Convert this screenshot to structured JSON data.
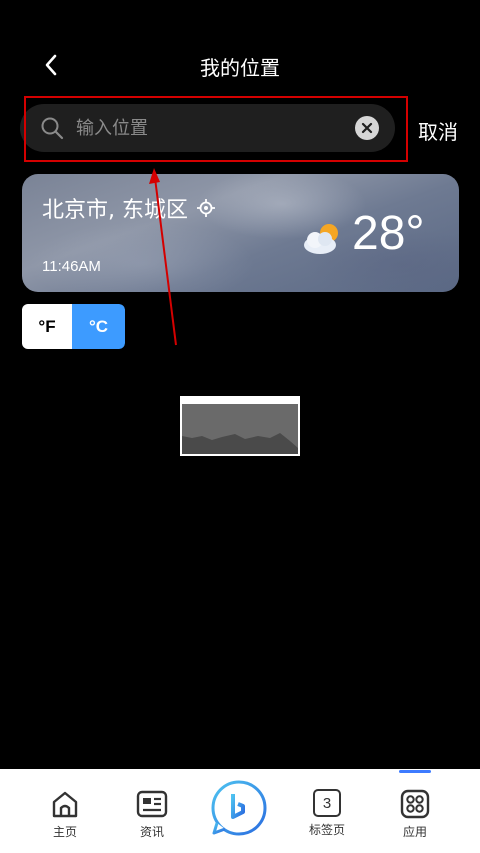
{
  "header": {
    "title": "我的位置",
    "back_icon": "chevron-left-icon"
  },
  "search": {
    "placeholder": "输入位置",
    "value": "",
    "cancel_label": "取消"
  },
  "weather": {
    "city": "北京市, 东城区",
    "time": "11:46AM",
    "temperature": "28°",
    "condition_icon": "partly-cloudy-icon"
  },
  "units": {
    "f_label": "°F",
    "c_label": "°C",
    "selected": "°C"
  },
  "nav": {
    "items": [
      {
        "label": "主页",
        "icon": "home-icon"
      },
      {
        "label": "资讯",
        "icon": "news-icon"
      },
      {
        "label": "",
        "icon": "bing-icon"
      },
      {
        "label": "标签页",
        "icon": "tabs-icon",
        "count": "3"
      },
      {
        "label": "应用",
        "icon": "apps-icon"
      }
    ]
  },
  "colors": {
    "accent": "#3d9bff",
    "highlight": "#d40000",
    "nav_indicator": "#3d7bff"
  }
}
